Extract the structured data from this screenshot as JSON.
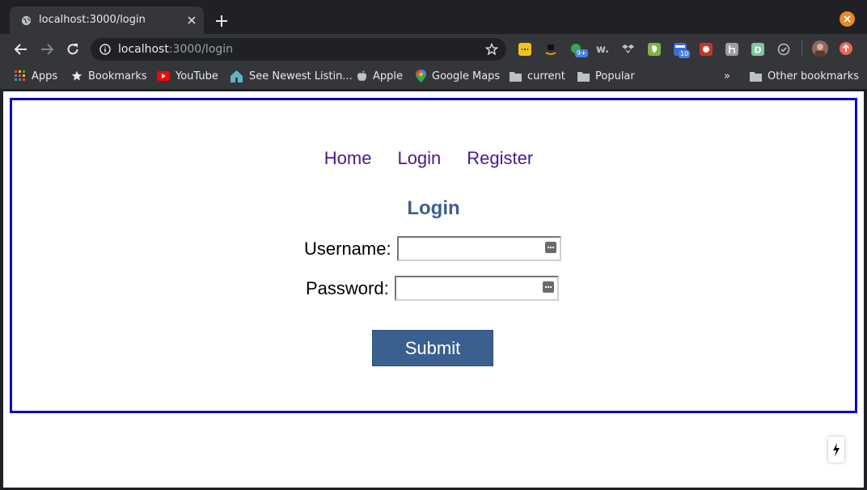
{
  "browser": {
    "tab_title": "localhost:3000/login",
    "url_host": "localhost",
    "url_rest": ":3000/login",
    "accent_close": "#e8892b",
    "extensions": [
      {
        "name": "notes-ext-icon",
        "color": "#f2c21b"
      },
      {
        "name": "amazon-ext-icon",
        "color": "#35363a"
      },
      {
        "name": "green-ext-icon",
        "color": "#34a853",
        "badge": "9+"
      },
      {
        "name": "w-ext-icon",
        "color": "#35363a"
      },
      {
        "name": "dropbox-ext-icon",
        "color": "#35363a"
      },
      {
        "name": "evernote-ext-icon",
        "color": "#7ab648"
      },
      {
        "name": "calendar-ext-icon",
        "color": "#3f6ad8",
        "badge": "10"
      },
      {
        "name": "red-ext-icon",
        "color": "#c0392b"
      },
      {
        "name": "grey-ext-icon",
        "color": "#9e9e9e"
      },
      {
        "name": "d-ext-icon",
        "color": "#7fc79b"
      },
      {
        "name": "check-ext-icon",
        "color": "#35363a"
      }
    ],
    "bookmarks": [
      {
        "label": "Apps",
        "icon": "apps-grid-icon"
      },
      {
        "label": "Bookmarks",
        "icon": "star-icon"
      },
      {
        "label": "YouTube",
        "icon": "youtube-icon"
      },
      {
        "label": "See Newest Listin...",
        "icon": "house-icon"
      },
      {
        "label": "Apple",
        "icon": "apple-icon"
      },
      {
        "label": "Google Maps",
        "icon": "maps-pin-icon"
      },
      {
        "label": "current",
        "icon": "folder-icon"
      },
      {
        "label": "Popular",
        "icon": "folder-icon"
      }
    ],
    "more_bookmarks": "»",
    "other_bookmarks": "Other bookmarks"
  },
  "page": {
    "nav": [
      "Home",
      "Login",
      "Register"
    ],
    "title": "Login",
    "username_label": "Username:",
    "password_label": "Password:",
    "submit_label": "Submit",
    "frame_color": "#0000cc",
    "button_color": "#3a6090",
    "link_color": "#4b1a8a"
  }
}
